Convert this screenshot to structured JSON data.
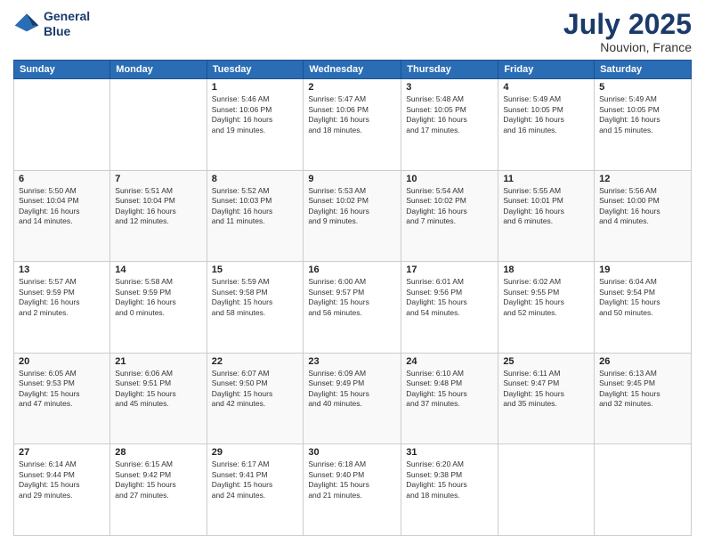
{
  "header": {
    "logo_line1": "General",
    "logo_line2": "Blue",
    "title": "July 2025",
    "subtitle": "Nouvion, France"
  },
  "weekdays": [
    "Sunday",
    "Monday",
    "Tuesday",
    "Wednesday",
    "Thursday",
    "Friday",
    "Saturday"
  ],
  "weeks": [
    [
      {
        "day": "",
        "content": ""
      },
      {
        "day": "",
        "content": ""
      },
      {
        "day": "1",
        "content": "Sunrise: 5:46 AM\nSunset: 10:06 PM\nDaylight: 16 hours\nand 19 minutes."
      },
      {
        "day": "2",
        "content": "Sunrise: 5:47 AM\nSunset: 10:06 PM\nDaylight: 16 hours\nand 18 minutes."
      },
      {
        "day": "3",
        "content": "Sunrise: 5:48 AM\nSunset: 10:05 PM\nDaylight: 16 hours\nand 17 minutes."
      },
      {
        "day": "4",
        "content": "Sunrise: 5:49 AM\nSunset: 10:05 PM\nDaylight: 16 hours\nand 16 minutes."
      },
      {
        "day": "5",
        "content": "Sunrise: 5:49 AM\nSunset: 10:05 PM\nDaylight: 16 hours\nand 15 minutes."
      }
    ],
    [
      {
        "day": "6",
        "content": "Sunrise: 5:50 AM\nSunset: 10:04 PM\nDaylight: 16 hours\nand 14 minutes."
      },
      {
        "day": "7",
        "content": "Sunrise: 5:51 AM\nSunset: 10:04 PM\nDaylight: 16 hours\nand 12 minutes."
      },
      {
        "day": "8",
        "content": "Sunrise: 5:52 AM\nSunset: 10:03 PM\nDaylight: 16 hours\nand 11 minutes."
      },
      {
        "day": "9",
        "content": "Sunrise: 5:53 AM\nSunset: 10:02 PM\nDaylight: 16 hours\nand 9 minutes."
      },
      {
        "day": "10",
        "content": "Sunrise: 5:54 AM\nSunset: 10:02 PM\nDaylight: 16 hours\nand 7 minutes."
      },
      {
        "day": "11",
        "content": "Sunrise: 5:55 AM\nSunset: 10:01 PM\nDaylight: 16 hours\nand 6 minutes."
      },
      {
        "day": "12",
        "content": "Sunrise: 5:56 AM\nSunset: 10:00 PM\nDaylight: 16 hours\nand 4 minutes."
      }
    ],
    [
      {
        "day": "13",
        "content": "Sunrise: 5:57 AM\nSunset: 9:59 PM\nDaylight: 16 hours\nand 2 minutes."
      },
      {
        "day": "14",
        "content": "Sunrise: 5:58 AM\nSunset: 9:59 PM\nDaylight: 16 hours\nand 0 minutes."
      },
      {
        "day": "15",
        "content": "Sunrise: 5:59 AM\nSunset: 9:58 PM\nDaylight: 15 hours\nand 58 minutes."
      },
      {
        "day": "16",
        "content": "Sunrise: 6:00 AM\nSunset: 9:57 PM\nDaylight: 15 hours\nand 56 minutes."
      },
      {
        "day": "17",
        "content": "Sunrise: 6:01 AM\nSunset: 9:56 PM\nDaylight: 15 hours\nand 54 minutes."
      },
      {
        "day": "18",
        "content": "Sunrise: 6:02 AM\nSunset: 9:55 PM\nDaylight: 15 hours\nand 52 minutes."
      },
      {
        "day": "19",
        "content": "Sunrise: 6:04 AM\nSunset: 9:54 PM\nDaylight: 15 hours\nand 50 minutes."
      }
    ],
    [
      {
        "day": "20",
        "content": "Sunrise: 6:05 AM\nSunset: 9:53 PM\nDaylight: 15 hours\nand 47 minutes."
      },
      {
        "day": "21",
        "content": "Sunrise: 6:06 AM\nSunset: 9:51 PM\nDaylight: 15 hours\nand 45 minutes."
      },
      {
        "day": "22",
        "content": "Sunrise: 6:07 AM\nSunset: 9:50 PM\nDaylight: 15 hours\nand 42 minutes."
      },
      {
        "day": "23",
        "content": "Sunrise: 6:09 AM\nSunset: 9:49 PM\nDaylight: 15 hours\nand 40 minutes."
      },
      {
        "day": "24",
        "content": "Sunrise: 6:10 AM\nSunset: 9:48 PM\nDaylight: 15 hours\nand 37 minutes."
      },
      {
        "day": "25",
        "content": "Sunrise: 6:11 AM\nSunset: 9:47 PM\nDaylight: 15 hours\nand 35 minutes."
      },
      {
        "day": "26",
        "content": "Sunrise: 6:13 AM\nSunset: 9:45 PM\nDaylight: 15 hours\nand 32 minutes."
      }
    ],
    [
      {
        "day": "27",
        "content": "Sunrise: 6:14 AM\nSunset: 9:44 PM\nDaylight: 15 hours\nand 29 minutes."
      },
      {
        "day": "28",
        "content": "Sunrise: 6:15 AM\nSunset: 9:42 PM\nDaylight: 15 hours\nand 27 minutes."
      },
      {
        "day": "29",
        "content": "Sunrise: 6:17 AM\nSunset: 9:41 PM\nDaylight: 15 hours\nand 24 minutes."
      },
      {
        "day": "30",
        "content": "Sunrise: 6:18 AM\nSunset: 9:40 PM\nDaylight: 15 hours\nand 21 minutes."
      },
      {
        "day": "31",
        "content": "Sunrise: 6:20 AM\nSunset: 9:38 PM\nDaylight: 15 hours\nand 18 minutes."
      },
      {
        "day": "",
        "content": ""
      },
      {
        "day": "",
        "content": ""
      }
    ]
  ]
}
